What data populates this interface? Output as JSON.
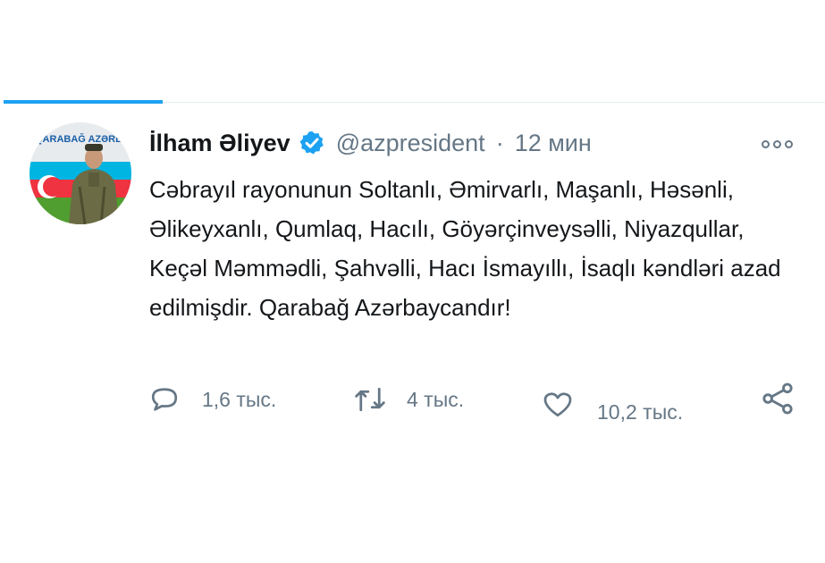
{
  "tweet": {
    "author_name": "İlham Əliyev",
    "handle": "@azpresident",
    "separator": "·",
    "time": "12 мин",
    "text": "Cəbrayıl rayonunun Soltanlı, Əmirvarlı, Maşanlı, Həsənli, Əlikeyxanlı, Qumlaq, Hacılı, Göyərçinveysəlli, Niyazqullar, Keçəl Məmmədli, Şahvəlli, Hacı İsmayıllı, İsaqlı kəndləri azad edilmişdir. Qarabağ Azərbaycandır!",
    "avatar_caption": "QARABAĞ AZƏRBAYCANDIR!"
  },
  "actions": {
    "reply_count": "1,6 тыс.",
    "retweet_count": "4 тыс.",
    "like_count": "10,2 тыс."
  },
  "icons": {
    "verified": "verified-badge-icon",
    "more": "more-options-icon",
    "reply": "reply-icon",
    "retweet": "retweet-icon",
    "like": "heart-icon",
    "share": "share-icon"
  },
  "colors": {
    "accent": "#1da1f2",
    "text": "#14171a",
    "muted": "#657786",
    "divider": "#e6ecf0"
  }
}
